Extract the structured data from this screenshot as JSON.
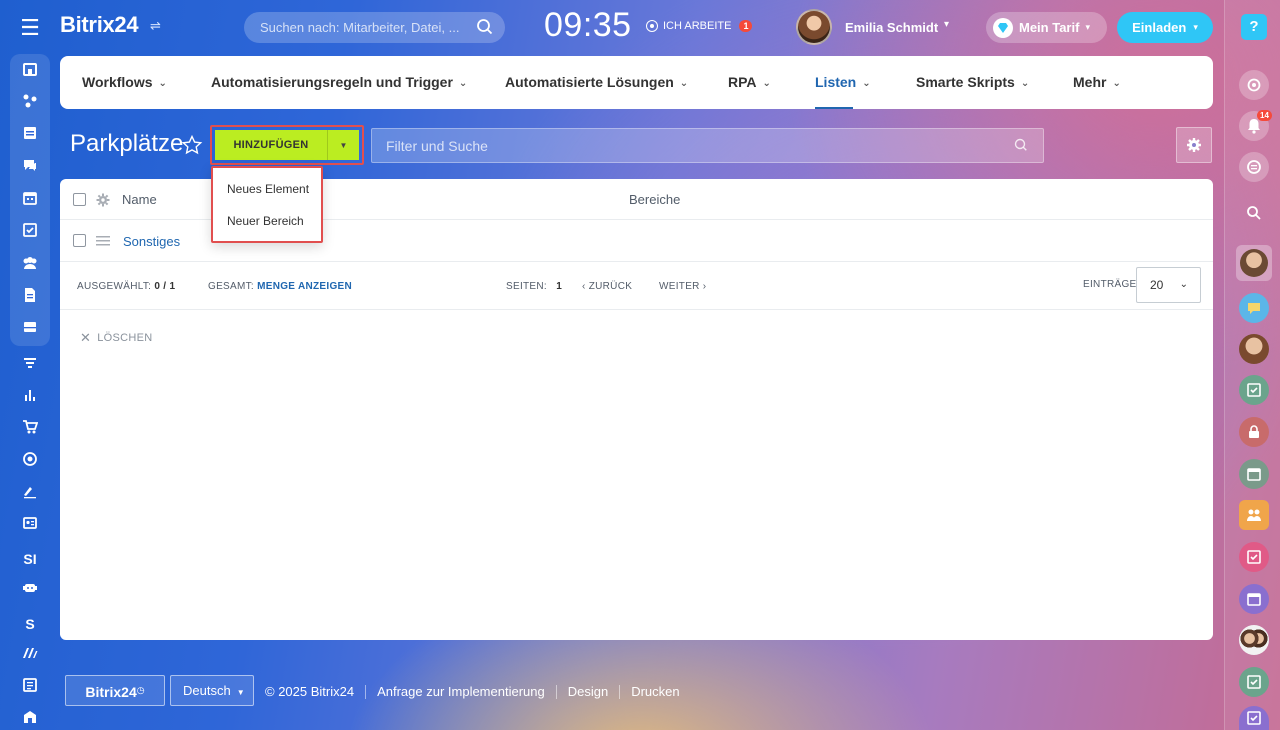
{
  "header": {
    "logo": "Bitrix24",
    "search_placeholder": "Suchen nach: Mitarbeiter, Datei, ...",
    "clock": "09:35",
    "work_status": "ICH ARBEITE",
    "work_status_count": "1",
    "user_name": "Emilia Schmidt",
    "tarif_label": "Mein Tarif",
    "invite_label": "Einladen"
  },
  "tabs": [
    {
      "label": "Workflows"
    },
    {
      "label": "Automatisierungsregeln und Trigger"
    },
    {
      "label": "Automatisierte Lösungen"
    },
    {
      "label": "RPA"
    },
    {
      "label": "Listen"
    },
    {
      "label": "Smarte Skripts"
    },
    {
      "label": "Mehr"
    }
  ],
  "page": {
    "title": "Parkplätze",
    "add_button": "HINZUFÜGEN",
    "filter_placeholder": "Filter und Suche"
  },
  "dropdown": {
    "items": [
      {
        "label": "Neues Element"
      },
      {
        "label": "Neuer Bereich"
      }
    ]
  },
  "grid": {
    "col_name": "Name",
    "col_sections": "Bereiche",
    "rows": [
      {
        "name": "Sonstiges"
      }
    ]
  },
  "pager": {
    "selected_label": "AUSGEWÄHLT:",
    "selected_value": "0 / 1",
    "total_label": "GESAMT:",
    "total_link": "MENGE ANZEIGEN",
    "pages_label": "SEITEN:",
    "page_value": "1",
    "back": "ZURÜCK",
    "next": "WEITER",
    "entries_label": "EINTRÄGE",
    "entries_value": "20"
  },
  "actions": {
    "delete": "LÖSCHEN"
  },
  "left_sidebar": {
    "labels": [
      "SI",
      "S"
    ]
  },
  "right_sidebar": {
    "notification_count": "14"
  },
  "footer": {
    "brand": "Bitrix24",
    "language": "Deutsch",
    "copyright": "© 2025 Bitrix24",
    "links": [
      {
        "label": "Anfrage zur Implementierung"
      },
      {
        "label": "Design"
      },
      {
        "label": "Drucken"
      }
    ]
  },
  "colors": {
    "accent_green": "#bbed21",
    "accent_blue": "#2fc6f6",
    "link_blue": "#2067b0",
    "highlight_red": "#e14f4f"
  }
}
